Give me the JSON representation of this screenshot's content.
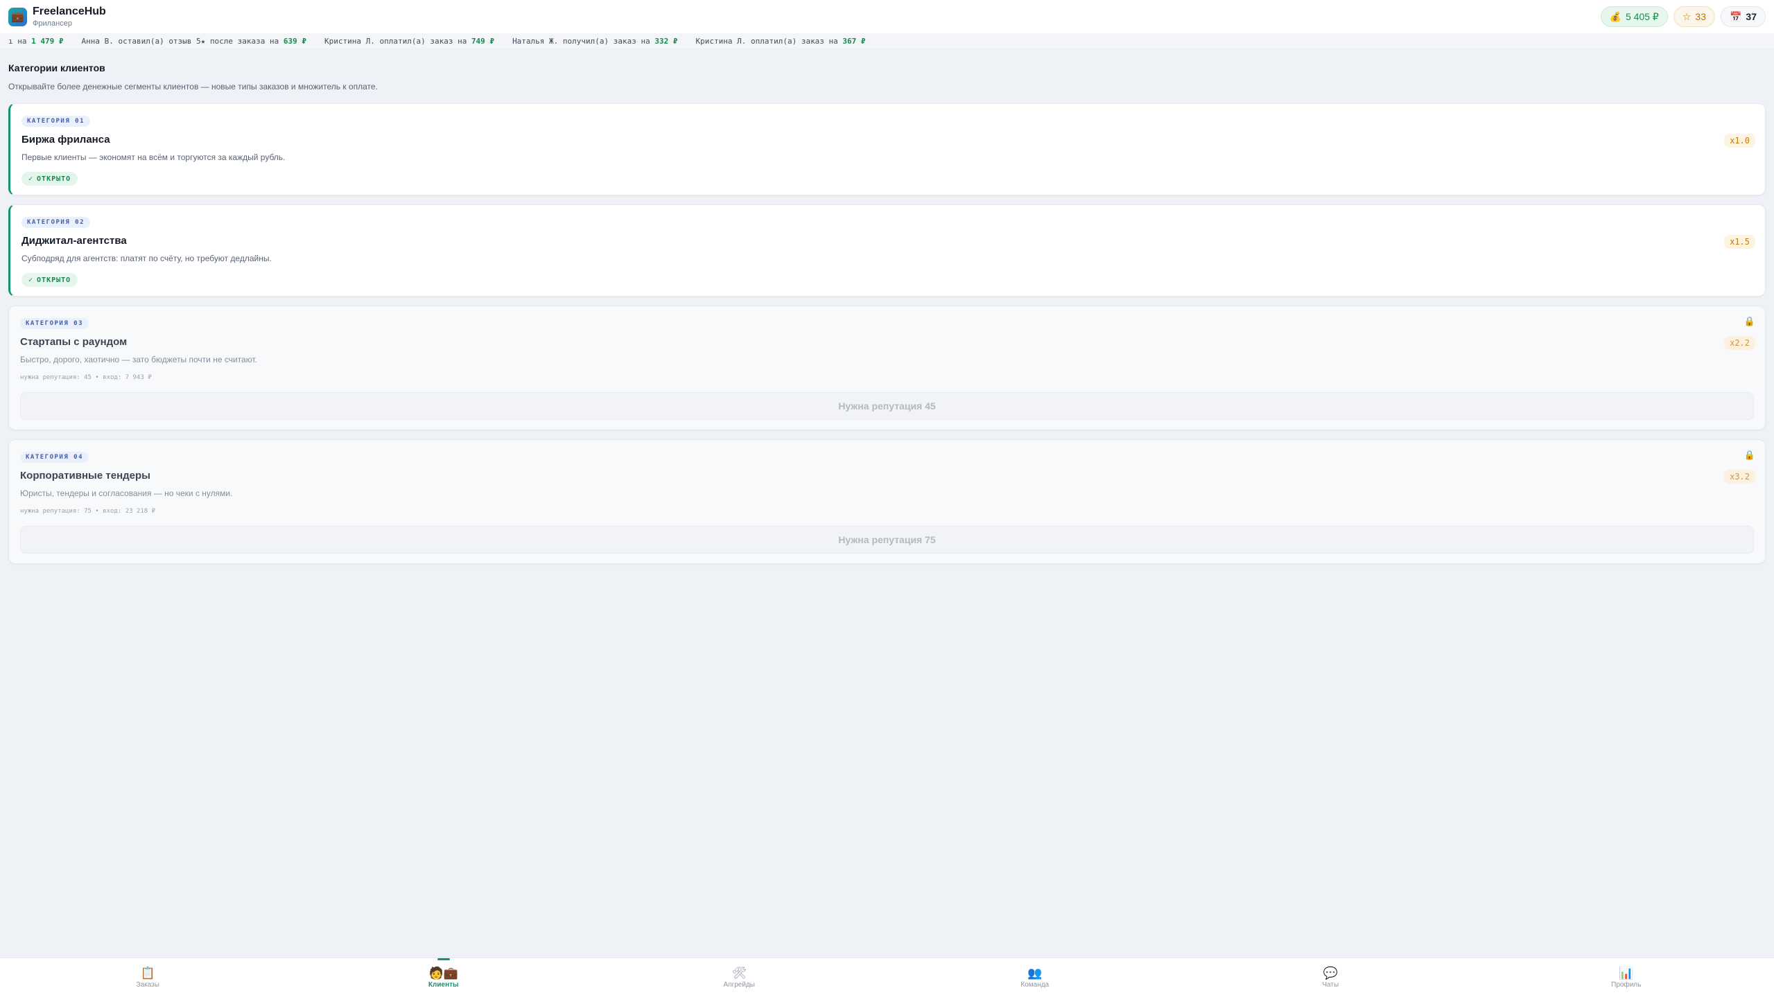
{
  "app": {
    "title": "FreelanceHub",
    "subtitle": "Фрилансер",
    "logo_icon": "briefcase-icon"
  },
  "stats": {
    "money": "5 405 ₽",
    "reputation": "33",
    "day": "37"
  },
  "ticker": [
    {
      "text": "ı на ",
      "amount": "1 479 ₽"
    },
    {
      "text": "Анна В. оставил(а) отзыв 5★ после заказа на ",
      "amount": "639 ₽"
    },
    {
      "text": "Кристина Л. оплатил(а) заказ на ",
      "amount": "749 ₽"
    },
    {
      "text": "Наталья Ж. получил(а) заказ на ",
      "amount": "332 ₽"
    },
    {
      "text": "Кристина Л. оплатил(а) заказ на ",
      "amount": "367 ₽"
    }
  ],
  "section": {
    "title": "Категории клиентов",
    "desc": "Открывайте более денежные сегменты клиентов — новые типы заказов и множитель к оплате."
  },
  "categories": [
    {
      "tag": "КАТЕГОРИЯ 01",
      "title": "Биржа фриланса",
      "desc": "Первые клиенты — экономят на всём и торгуются за каждый рубль.",
      "status": "ОТКРЫТО",
      "multiplier": "x1.0"
    },
    {
      "tag": "КАТЕГОРИЯ 02",
      "title": "Диджитал-агентства",
      "desc": "Субподряд для агентств: платят по счёту, но требуют дедлайны.",
      "status": "ОТКРЫТО",
      "multiplier": "x1.5"
    },
    {
      "tag": "КАТЕГОРИЯ 03",
      "title": "Стартапы с раундом",
      "desc": "Быстро, дорого, хаотично — зато бюджеты почти не считают.",
      "requirement": "нужна репутация: 45 • вход: 7 943 ₽",
      "button": "Нужна репутация 45",
      "multiplier": "x2.2"
    },
    {
      "tag": "КАТЕГОРИЯ 04",
      "title": "Корпоративные тендеры",
      "desc": "Юристы, тендеры и согласования — но чеки с нулями.",
      "requirement": "нужна репутация: 75 • вход: 23 218 ₽",
      "button": "Нужна репутация 75",
      "multiplier": "x3.2"
    }
  ],
  "nav": [
    {
      "label": "Заказы",
      "icon": "clipboard-icon"
    },
    {
      "label": "Клиенты",
      "icon": "clients-icon",
      "active": true
    },
    {
      "label": "Апгрейды",
      "icon": "tools-icon"
    },
    {
      "label": "Команда",
      "icon": "team-icon"
    },
    {
      "label": "Чаты",
      "icon": "chat-icon"
    },
    {
      "label": "Профиль",
      "icon": "chart-icon"
    }
  ],
  "colors": {
    "accent": "#15946a",
    "money": "#188a4f",
    "multiplier": "#c07a10",
    "tag": "#3f5fa8"
  }
}
